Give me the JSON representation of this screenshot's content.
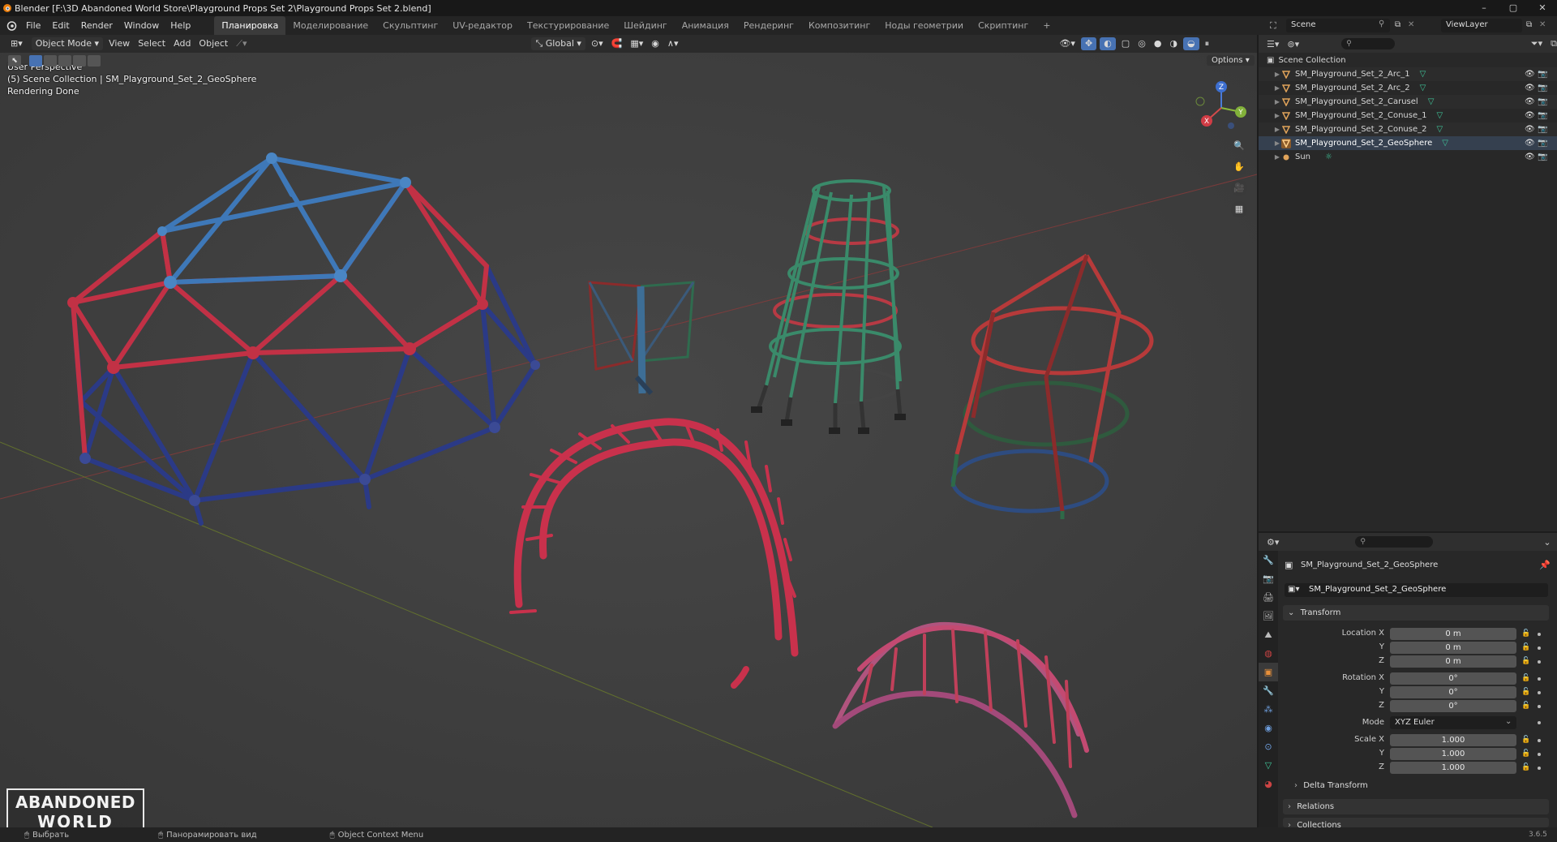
{
  "titlebar": {
    "title": "Blender [F:\\3D Abandoned World Store\\Playground Props Set 2\\Playground Props Set 2.blend]",
    "minimize": "–",
    "maximize": "▢",
    "close": "✕"
  },
  "menubar": {
    "items": [
      "File",
      "Edit",
      "Render",
      "Window",
      "Help"
    ],
    "workspaces": [
      "Планировка",
      "Моделирование",
      "Скульптинг",
      "UV-редактор",
      "Текстурирование",
      "Шейдинг",
      "Анимация",
      "Рендеринг",
      "Композитинг",
      "Ноды геометрии",
      "Скриптинг"
    ],
    "active_workspace": 0,
    "add_workspace": "+",
    "scene_label": "Scene",
    "viewlayer_label": "ViewLayer"
  },
  "viewport_header": {
    "mode": "Object Mode",
    "menus": [
      "View",
      "Select",
      "Add",
      "Object"
    ],
    "transform_orientation": "Global",
    "options": "Options"
  },
  "viewport": {
    "info_lines": [
      "User Perspective",
      "(5) Scene Collection | SM_Playground_Set_2_GeoSphere",
      "Rendering Done"
    ],
    "gizmo": {
      "x": "X",
      "y": "Y",
      "z": "Z"
    },
    "logo": {
      "line1": "ABANDONED",
      "line2": "WORLD"
    },
    "colors": {
      "background": "#3e3e3e",
      "red_axis": "#8a3b3b",
      "green_axis": "#6b7d2a"
    }
  },
  "outliner": {
    "root": "Scene Collection",
    "items": [
      {
        "name": "SM_Playground_Set_2_Arc_1",
        "type": "mesh"
      },
      {
        "name": "SM_Playground_Set_2_Arc_2",
        "type": "mesh"
      },
      {
        "name": "SM_Playground_Set_2_Carusel",
        "type": "mesh"
      },
      {
        "name": "SM_Playground_Set_2_Conuse_1",
        "type": "mesh"
      },
      {
        "name": "SM_Playground_Set_2_Conuse_2",
        "type": "mesh"
      },
      {
        "name": "SM_Playground_Set_2_GeoSphere",
        "type": "mesh",
        "selected": true
      },
      {
        "name": "Sun",
        "type": "light"
      }
    ]
  },
  "properties": {
    "object_name": "SM_Playground_Set_2_GeoSphere",
    "datablock_name": "SM_Playground_Set_2_GeoSphere",
    "transform_label": "Transform",
    "location": {
      "label": "Location X",
      "x": "0 m",
      "y": "0 m",
      "z": "0 m"
    },
    "rotation": {
      "label": "Rotation X",
      "x": "0°",
      "y": "0°",
      "z": "0°"
    },
    "mode": {
      "label": "Mode",
      "value": "XYZ Euler"
    },
    "scale": {
      "label": "Scale X",
      "x": "1.000",
      "y": "1.000",
      "z": "1.000"
    },
    "axis_y": "Y",
    "axis_z": "Z",
    "subpanels": [
      "Delta Transform",
      "Relations",
      "Collections"
    ]
  },
  "statusbar": {
    "left_hint": "Выбрать",
    "middle_hint": "Панорамировать вид",
    "right_hint": "Object Context Menu",
    "version": "3.6.5"
  }
}
